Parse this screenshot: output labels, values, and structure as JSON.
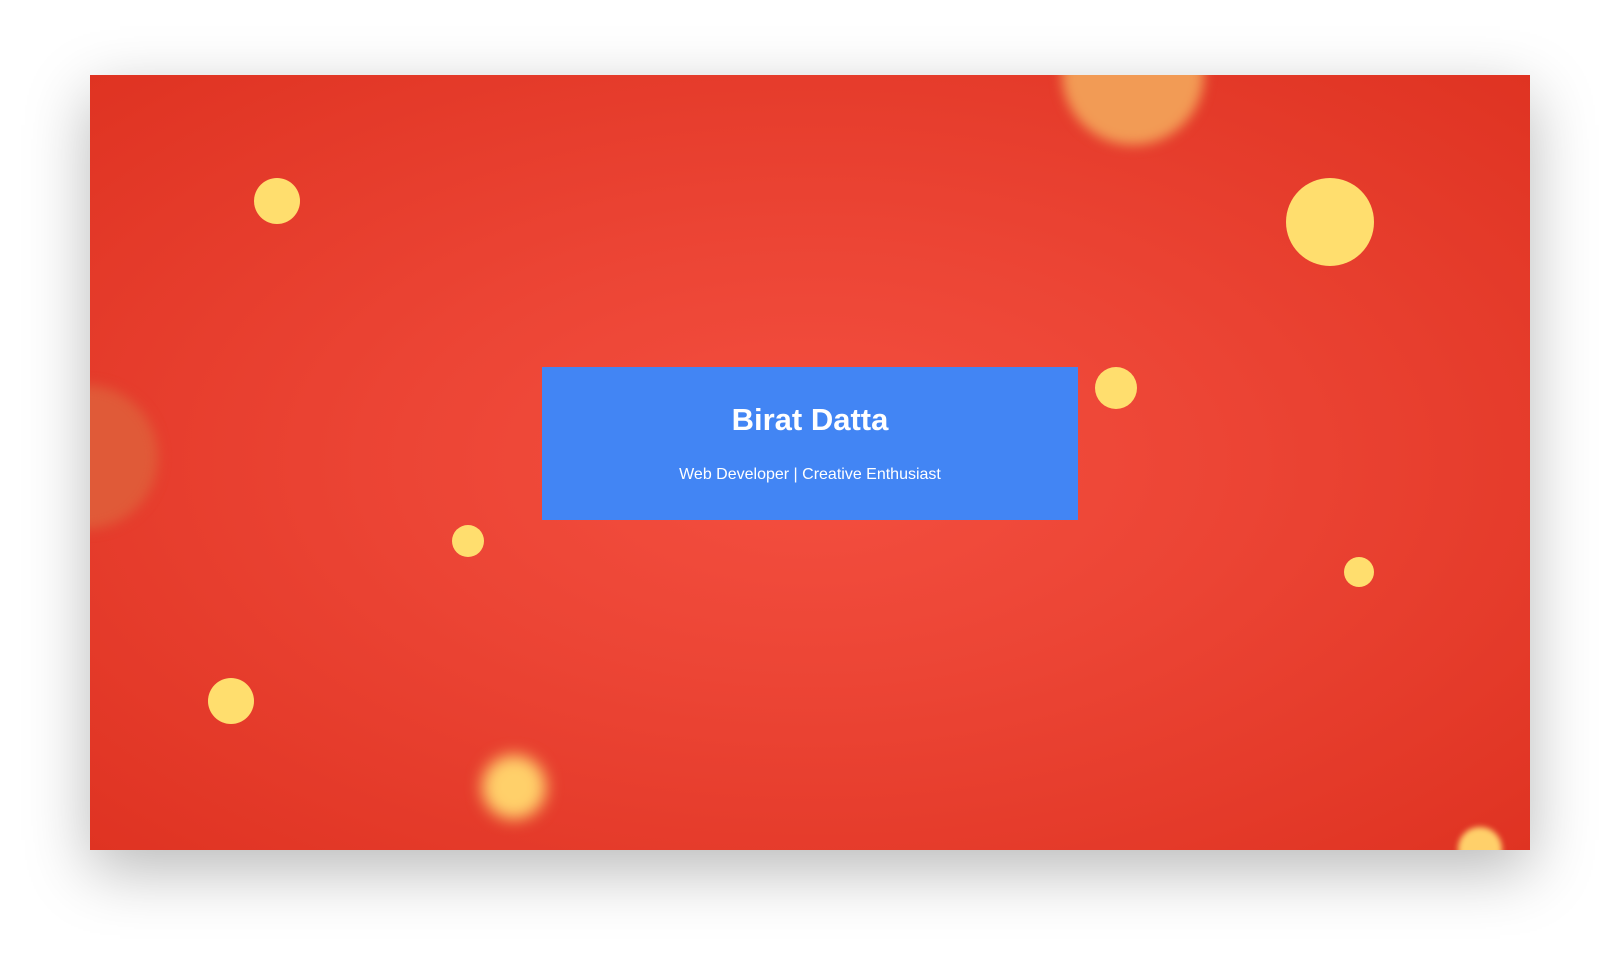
{
  "profile": {
    "name": "Birat Datta",
    "tagline": "Web Developer | Creative Enthusiast"
  },
  "colors": {
    "background_red": "#df3322",
    "card_blue": "#4285f4",
    "dot_yellow": "#ffde6e",
    "glow_orange": "#f29b55"
  }
}
